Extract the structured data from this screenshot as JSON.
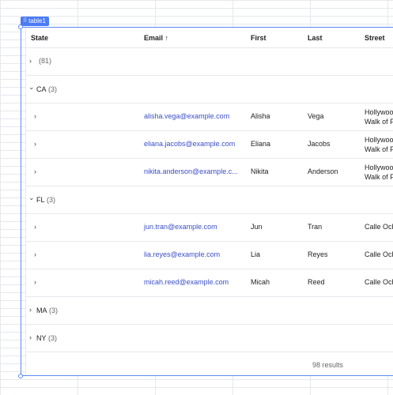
{
  "component": {
    "tag_label": "table1"
  },
  "columns": {
    "state": "State",
    "email": "Email",
    "email_sort": "↑",
    "first": "First",
    "last": "Last",
    "street": "Street"
  },
  "groups": {
    "blank": {
      "chevron": "›",
      "label": "",
      "count": "(81)"
    },
    "ca": {
      "chevron": "⌄",
      "label": "CA",
      "count": "(3)"
    },
    "fl": {
      "chevron": "⌄",
      "label": "FL",
      "count": "(3)"
    },
    "ma": {
      "chevron": "›",
      "label": "MA",
      "count": "(3)"
    },
    "ny": {
      "chevron": "›",
      "label": "NY",
      "count": "(3)"
    }
  },
  "rows": [
    {
      "chevron": "›",
      "email": "alisha.vega@example.com",
      "first": "Alisha",
      "last": "Vega",
      "street_1": "Hollywoo",
      "street_2": "Walk of F"
    },
    {
      "chevron": "›",
      "email": "eliana.jacobs@example.com",
      "first": "Eliana",
      "last": "Jacobs",
      "street_1": "Hollywoo",
      "street_2": "Walk of F"
    },
    {
      "chevron": "›",
      "email": "nikita.anderson@example.c...",
      "first": "Nikita",
      "last": "Anderson",
      "street_1": "Hollywoo",
      "street_2": "Walk of F"
    },
    {
      "chevron": "›",
      "email": "jun.tran@example.com",
      "first": "Jun",
      "last": "Tran",
      "street_1": "Calle Och",
      "street_2": ""
    },
    {
      "chevron": "›",
      "email": "lia.reyes@example.com",
      "first": "Lia",
      "last": "Reyes",
      "street_1": "Calle Och",
      "street_2": ""
    },
    {
      "chevron": "›",
      "email": "micah.reed@example.com",
      "first": "Micah",
      "last": "Reed",
      "street_1": "Calle Och",
      "street_2": ""
    }
  ],
  "footer": {
    "results": "98 results"
  },
  "colors": {
    "accent": "#4b7bf5",
    "link": "#3b4fc4",
    "border": "#e6e8ec"
  }
}
